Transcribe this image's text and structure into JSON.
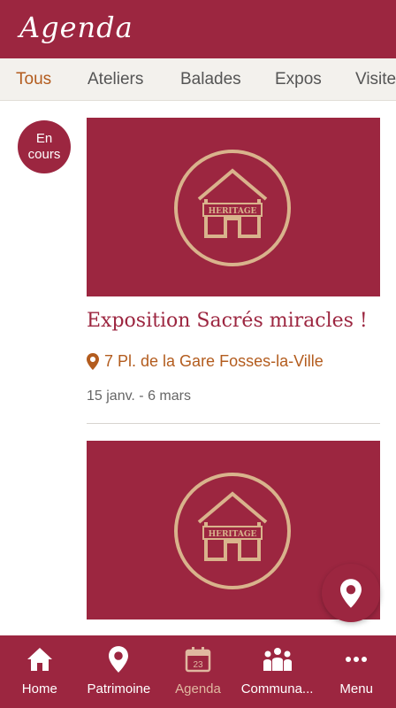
{
  "header": {
    "title": "Agenda"
  },
  "tabs": [
    {
      "label": "Tous",
      "active": true
    },
    {
      "label": "Ateliers"
    },
    {
      "label": "Balades"
    },
    {
      "label": "Expos"
    },
    {
      "label": "Visites"
    }
  ],
  "events": [
    {
      "status": [
        "En",
        "cours"
      ],
      "image_logo_text": "HERITAGE",
      "title": "Exposition Sacrés miracles !",
      "location": "7 Pl. de la Gare Fosses-la-Ville",
      "dates": "15 janv. - 6 mars"
    },
    {
      "image_logo_text": "HERITAGE"
    }
  ],
  "bottom_nav": [
    {
      "label": "Home",
      "icon": "home-icon"
    },
    {
      "label": "Patrimoine",
      "icon": "map-pin-icon"
    },
    {
      "label": "Agenda",
      "icon": "calendar-icon",
      "active": true,
      "calendar_day": "23"
    },
    {
      "label": "Communa...",
      "icon": "community-icon"
    },
    {
      "label": "Menu",
      "icon": "more-dots-icon"
    }
  ],
  "colors": {
    "brand": "#9c2640",
    "accent": "#b35c1e",
    "logo": "#d9b38c",
    "active_nav": "#e0b8a0"
  }
}
